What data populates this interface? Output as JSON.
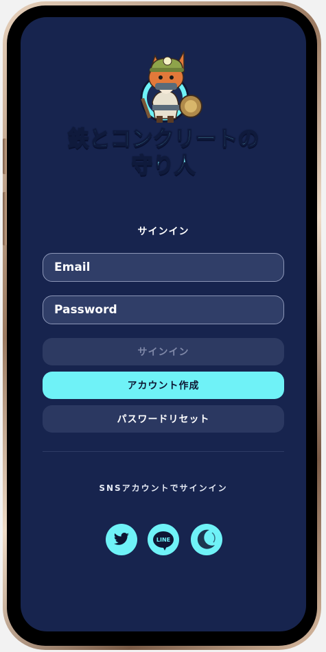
{
  "header": {
    "mascot": "fox-miner-mascot-icon",
    "title_line1": "鉄とコンクリートの",
    "title_line2": "守り人"
  },
  "signin_form": {
    "heading": "サインイン",
    "email_placeholder": "Email",
    "password_placeholder": "Password",
    "signin_label": "サインイン",
    "create_account_label": "アカウント作成",
    "password_reset_label": "パスワードリセット"
  },
  "sns": {
    "heading": "SNSアカウントでサインイン",
    "buttons": [
      {
        "icon": "twitter-bird-icon"
      },
      {
        "icon": "line-icon",
        "label": "LINE"
      },
      {
        "icon": "crescent-logo-icon"
      }
    ]
  },
  "colors": {
    "screen_bg": "#17244e",
    "accent": "#6ff2f7",
    "field_bg": "#303e68",
    "disabled_button": "#2d3a62"
  }
}
